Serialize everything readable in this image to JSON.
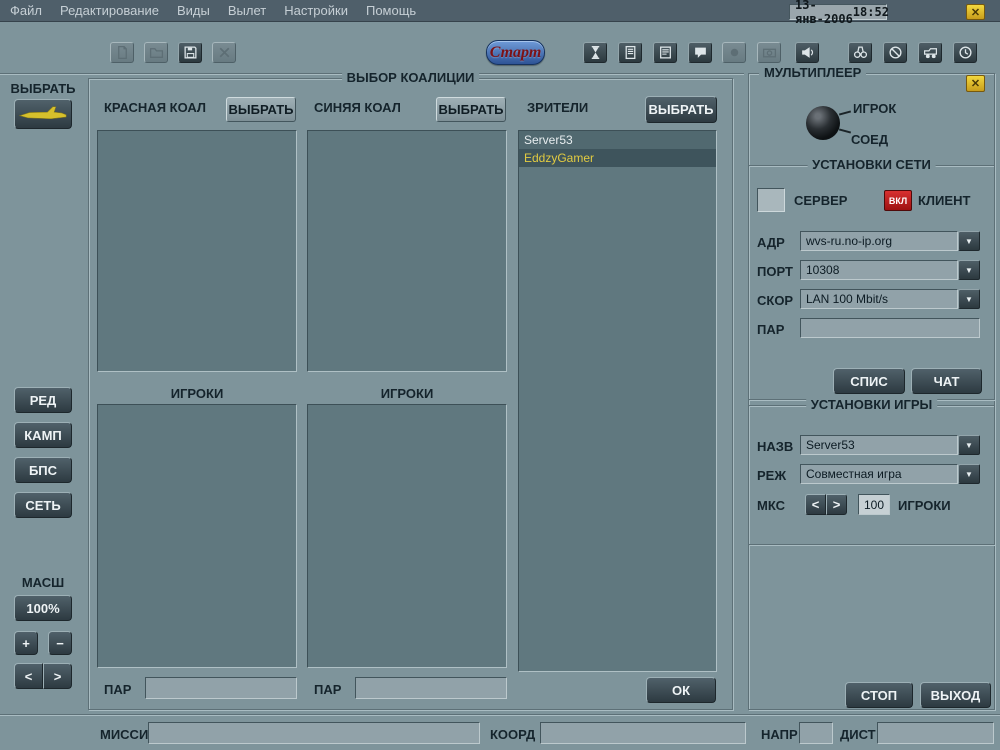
{
  "menu": {
    "items": [
      "Файл",
      "Редактирование",
      "Виды",
      "Вылет",
      "Настройки",
      "Помощь"
    ],
    "date": "13-янв-2006",
    "time": "18:52"
  },
  "glyphs": {
    "close": "✕",
    "dropdown": "▼",
    "plus": "+",
    "minus": "−",
    "left": "<",
    "right": ">"
  },
  "toolbar": {
    "start_label": "Старт"
  },
  "sidebar": {
    "select_label": "ВЫБРАТЬ",
    "buttons": [
      "РЕД",
      "КАМП",
      "БПС",
      "СЕТЬ"
    ],
    "zoom_label": "МАСШ",
    "zoom_value": "100%"
  },
  "coalition": {
    "title": "ВЫБОР КОАЛИЦИИ",
    "red": {
      "label": "КРАСНАЯ КОАЛ",
      "select_label": "ВЫБРАТЬ",
      "players_label": "ИГРОКИ",
      "password_label": "ПАР",
      "password_value": ""
    },
    "blue": {
      "label": "СИНЯЯ КОАЛ",
      "select_label": "ВЫБРАТЬ",
      "players_label": "ИГРОКИ",
      "password_label": "ПАР",
      "password_value": ""
    },
    "spectators": {
      "label": "ЗРИТЕЛИ",
      "select_label": "ВЫБРАТЬ",
      "items": [
        "Server53",
        "EddzyGamer"
      ],
      "selected": "EddzyGamer",
      "ok_label": "ОК"
    }
  },
  "multiplayer": {
    "title": "МУЛЬТИПЛЕЕР",
    "player_label": "ИГРОК",
    "connection_label": "СОЕД",
    "network": {
      "title": "УСТАНОВКИ СЕТИ",
      "server_label": "СЕРВЕР",
      "toggle_label": "ВКЛ",
      "client_label": "КЛИЕНТ",
      "rows": [
        {
          "label": "АДР",
          "value": "wvs-ru.no-ip.org"
        },
        {
          "label": "ПОРТ",
          "value": "10308"
        },
        {
          "label": "СКОР",
          "value": "LAN 100 Mbit/s"
        },
        {
          "label": "ПАР",
          "value": ""
        }
      ],
      "list_label": "СПИС",
      "chat_label": "ЧАТ"
    },
    "game": {
      "title": "УСТАНОВКИ ИГРЫ",
      "rows": [
        {
          "label": "НАЗВ",
          "value": "Server53"
        },
        {
          "label": "РЕЖ",
          "value": "Совместная игра"
        }
      ],
      "max_label": "МКС",
      "max_value": "100",
      "players_label": "ИГРОКИ"
    },
    "stop_label": "СТОП",
    "exit_label": "ВЫХОД"
  },
  "statusbar": {
    "mission_label": "МИССИЯ",
    "mission_value": "",
    "coord_label": "КООРД",
    "coord_value": "",
    "heading_label": "НАПР",
    "heading_value": "",
    "distance_label": "ДИСТ",
    "distance_value": ""
  }
}
